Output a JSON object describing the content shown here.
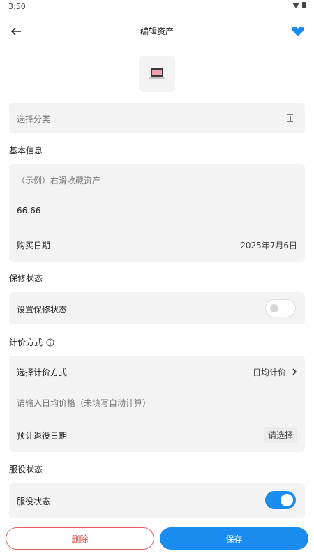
{
  "status_bar": {
    "time": "3:50"
  },
  "header": {
    "title": "编辑资产"
  },
  "category": {
    "placeholder": "选择分类"
  },
  "basic_info": {
    "section_title": "基本信息",
    "name_placeholder": "（示例）右滑收藏资产",
    "price": "66.66",
    "purchase_date_label": "购买日期",
    "purchase_date_value": "2025年7月6日"
  },
  "warranty": {
    "section_title": "保修状态",
    "label": "设置保修状态",
    "enabled": false
  },
  "pricing": {
    "section_title": "计价方式",
    "method_label": "选择计价方式",
    "method_value": "日均计价",
    "daily_price_placeholder": "请输入日均价格（未填写自动计算）",
    "retire_label": "预计退役日期",
    "retire_value": "请选择"
  },
  "service": {
    "section_title": "服役状态",
    "label": "服役状态",
    "enabled": true
  },
  "actions": {
    "delete_label": "删除",
    "save_label": "保存"
  },
  "colors": {
    "accent": "#1a8cf0",
    "danger": "#e04848",
    "card_bg": "#f3f3f3"
  },
  "icons": {
    "back": "arrow-left-icon",
    "favorite": "heart-icon",
    "asset": "laptop-icon",
    "sort": "sort-icon",
    "info": "info-icon",
    "chevron": "chevron-right-icon"
  }
}
